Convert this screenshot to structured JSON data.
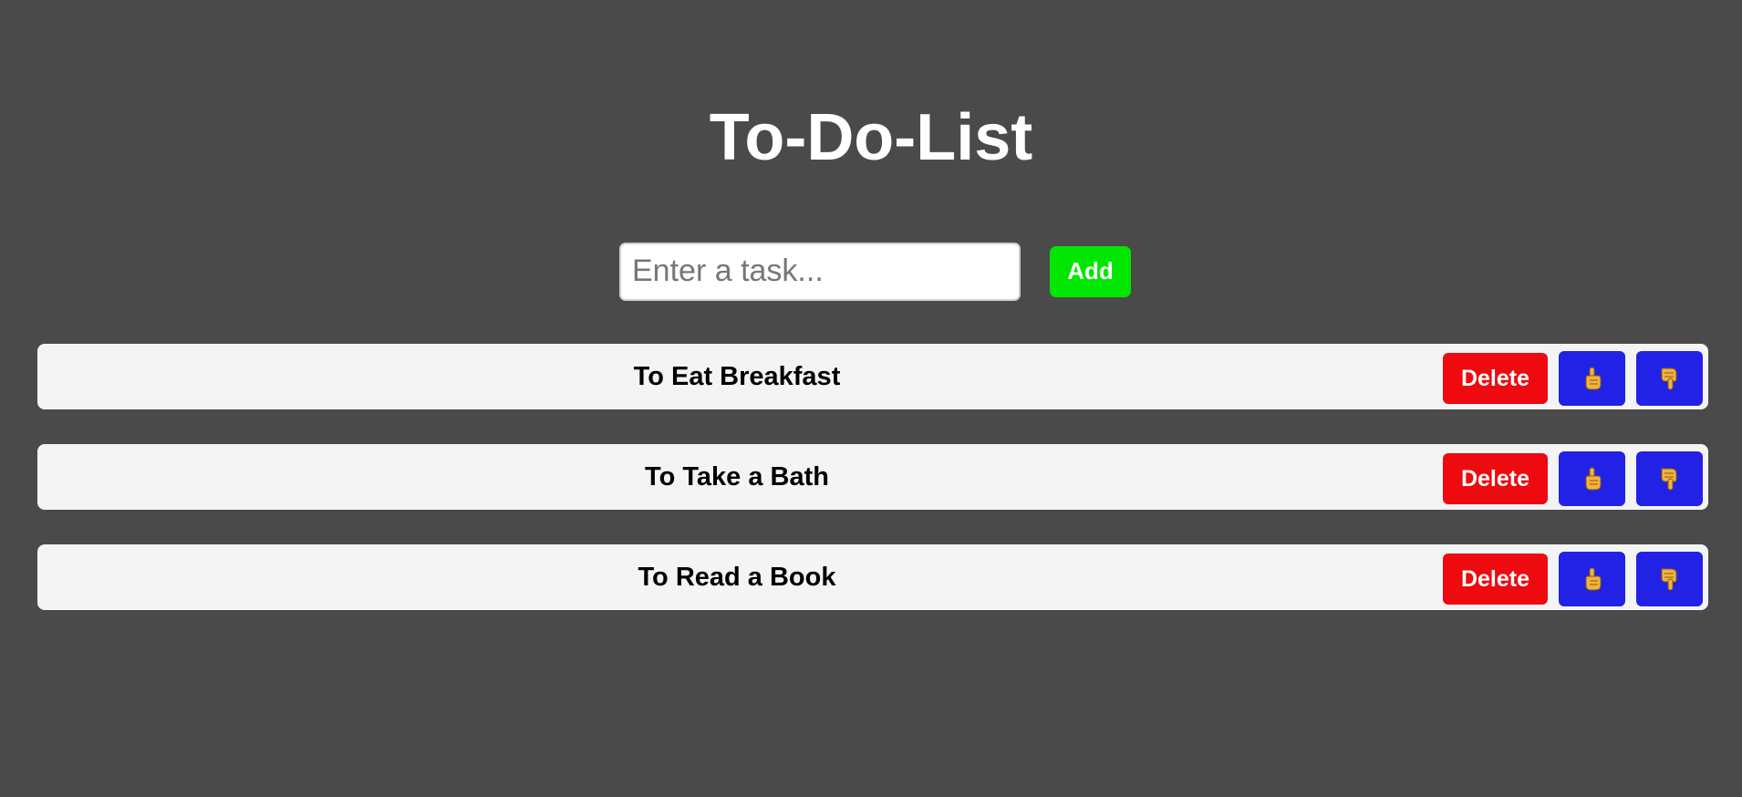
{
  "app": {
    "title": "To-Do-List"
  },
  "input": {
    "placeholder": "Enter a task...",
    "value": ""
  },
  "add_button_label": "Add",
  "tasks": [
    {
      "text": "To Eat Breakfast",
      "delete_label": "Delete",
      "up_icon": "hand-pointing-up-icon",
      "down_icon": "hand-pointing-down-icon"
    },
    {
      "text": "To Take a Bath",
      "delete_label": "Delete",
      "up_icon": "hand-pointing-up-icon",
      "down_icon": "hand-pointing-down-icon"
    },
    {
      "text": "To Read a Book",
      "delete_label": "Delete",
      "up_icon": "hand-pointing-up-icon",
      "down_icon": "hand-pointing-down-icon"
    }
  ],
  "colors": {
    "background": "#4a4a4a",
    "add_button": "#00e600",
    "delete_button": "#ee0a0f",
    "move_button": "#2222e6",
    "task_row": "#f4f4f4",
    "hand_icon": "#f2b33d"
  }
}
